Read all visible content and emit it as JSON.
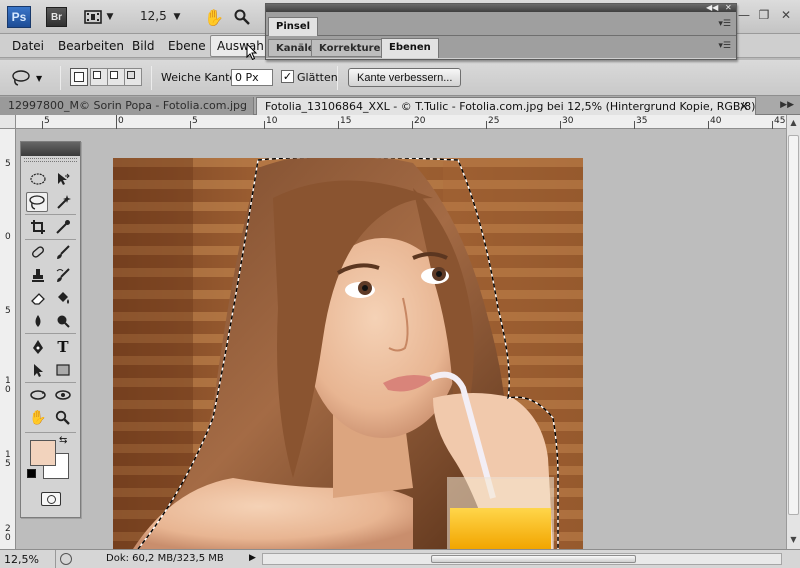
{
  "app": {
    "logo": "Ps",
    "bridge_logo": "Br",
    "zoom_value": "12,5",
    "icons": [
      "film-strip-icon",
      "dropdown-arrow-icon",
      "hand-icon",
      "magnifier-icon"
    ]
  },
  "menu": {
    "items": [
      "Datei",
      "Bearbeiten",
      "Bild",
      "Ebene",
      "Auswahl"
    ],
    "active": "Auswahl"
  },
  "options": {
    "feather_label": "Weiche Kante:",
    "feather_value": "0 Px",
    "smooth_label": "Glätten",
    "smooth_checked": true,
    "refine_button": "Kante verbessern..."
  },
  "tabs": [
    {
      "label": "12997800_M© Sorin Popa - Fotolia.com.jpg",
      "active": false
    },
    {
      "label": "Fotolia_13106864_XXL - © T.Tulic - Fotolia.com.jpg bei 12,5% (Hintergrund Kopie, RGB/8) *",
      "active": true
    }
  ],
  "tab_close": "×",
  "ruler_h_labels": [
    "5",
    "0",
    "5",
    "10",
    "15",
    "20",
    "25",
    "30",
    "35",
    "40",
    "45"
  ],
  "ruler_v_labels": [
    "5",
    "0",
    "5",
    "1\n0",
    "1\n5",
    "2\n0"
  ],
  "panel": {
    "title": "Pinsel",
    "tabs": [
      "Kanäle",
      "Korrekturen",
      "Ebenen"
    ],
    "active_tab": "Ebenen"
  },
  "status": {
    "zoom": "12,5%",
    "doc": "Dok: 60,2 MB/323,5 MB"
  },
  "colors": {
    "foreground": "#f2d3bd",
    "background": "#ffffff",
    "accent": "#1d4c95"
  }
}
